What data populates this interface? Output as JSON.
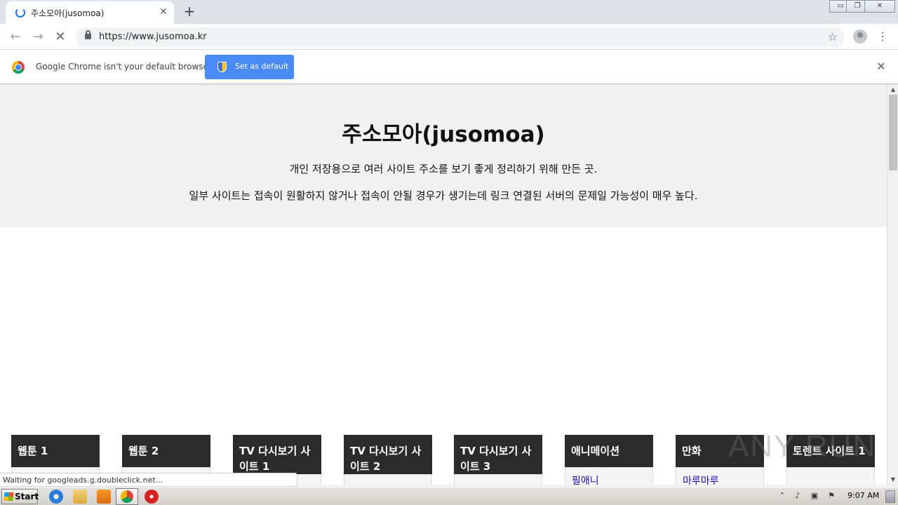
{
  "browser": {
    "tab_title": "주소모아(jusomoa)",
    "tab_close": "✕",
    "new_tab": "+",
    "url": "https://www.jusomoa.kr",
    "back": "←",
    "forward": "→",
    "reload_stop": "✕",
    "bookmark_star": "☆",
    "menu": "⋮",
    "window_controls": {
      "minimize": "▭",
      "restore": "❐",
      "close": "✕"
    }
  },
  "infobar": {
    "message": "Google Chrome isn't your default browser",
    "button_label": "Set as default",
    "close": "✕"
  },
  "page": {
    "title": "주소모아(jusomoa)",
    "line1": "개인 저장용으로 여러 사이트 주소를 보기 좋게 정리하기 위해 만든 곳.",
    "line2": "일부 사이트는 접속이 원활하지 않거나 접속이 안될 경우가 생기는데 링크 연결된 서버의 문제일 가능성이 매우 높다.",
    "categories": [
      {
        "label": "웹툰 1",
        "link": ""
      },
      {
        "label": "웹툰 2",
        "link": ""
      },
      {
        "label": "TV 다시보기 사이트 1",
        "link": ""
      },
      {
        "label": "TV 다시보기 사이트 2",
        "link": ""
      },
      {
        "label": "TV 다시보기 사이트 3",
        "link": ""
      },
      {
        "label": "애니메이션",
        "link": "필애니"
      },
      {
        "label": "만화",
        "link": "마루마루"
      },
      {
        "label": "토렌트 사이트 1",
        "link": ""
      }
    ]
  },
  "status_text": "Waiting for googleads.g.doubleclick.net...",
  "watermark": "ANY RUN",
  "taskbar": {
    "start_label": "Start",
    "clock": "9:07 AM",
    "tray_icons": [
      "chevron-up-icon",
      "speaker-icon",
      "network-icon",
      "flag-icon"
    ]
  },
  "colors": {
    "accent": "#4a8af4",
    "category_header": "#2b2b2b",
    "link": "#1a0dab",
    "hero_bg": "#f1f1f1"
  }
}
